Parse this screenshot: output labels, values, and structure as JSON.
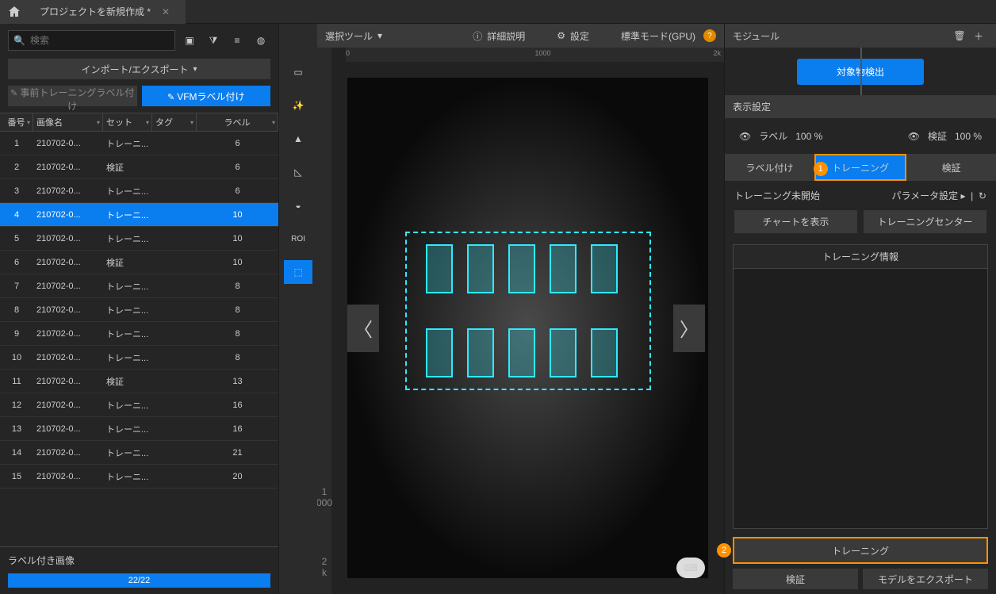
{
  "titlebar": {
    "project": "プロジェクトを新規作成 *"
  },
  "left": {
    "search_placeholder": "検索",
    "import_export": "インポート/エクスポート",
    "pretrain_label": "事前トレーニングラベル付け",
    "vfm_label": "VFMラベル付け",
    "columns": {
      "num": "番号",
      "name": "画像名",
      "set": "セット",
      "tag": "タグ",
      "labels": "ラベル"
    },
    "rows": [
      {
        "n": "1",
        "name": "210702-0...",
        "set": "トレーニ...",
        "tag": "",
        "lab": "6"
      },
      {
        "n": "2",
        "name": "210702-0...",
        "set": "検証",
        "tag": "",
        "lab": "6"
      },
      {
        "n": "3",
        "name": "210702-0...",
        "set": "トレーニ...",
        "tag": "",
        "lab": "6"
      },
      {
        "n": "4",
        "name": "210702-0...",
        "set": "トレーニ...",
        "tag": "",
        "lab": "10"
      },
      {
        "n": "5",
        "name": "210702-0...",
        "set": "トレーニ...",
        "tag": "",
        "lab": "10"
      },
      {
        "n": "6",
        "name": "210702-0...",
        "set": "検証",
        "tag": "",
        "lab": "10"
      },
      {
        "n": "7",
        "name": "210702-0...",
        "set": "トレーニ...",
        "tag": "",
        "lab": "8"
      },
      {
        "n": "8",
        "name": "210702-0...",
        "set": "トレーニ...",
        "tag": "",
        "lab": "8"
      },
      {
        "n": "9",
        "name": "210702-0...",
        "set": "トレーニ...",
        "tag": "",
        "lab": "8"
      },
      {
        "n": "10",
        "name": "210702-0...",
        "set": "トレーニ...",
        "tag": "",
        "lab": "8"
      },
      {
        "n": "11",
        "name": "210702-0...",
        "set": "検証",
        "tag": "",
        "lab": "13"
      },
      {
        "n": "12",
        "name": "210702-0...",
        "set": "トレーニ...",
        "tag": "",
        "lab": "16"
      },
      {
        "n": "13",
        "name": "210702-0...",
        "set": "トレーニ...",
        "tag": "",
        "lab": "16"
      },
      {
        "n": "14",
        "name": "210702-0...",
        "set": "トレーニ...",
        "tag": "",
        "lab": "21"
      },
      {
        "n": "15",
        "name": "210702-0...",
        "set": "トレーニ...",
        "tag": "",
        "lab": "20"
      }
    ],
    "labeled_header": "ラベル付き画像",
    "labeled_count": "22/22"
  },
  "tools": {
    "roi": "ROI"
  },
  "center": {
    "select_tool": "選択ツール",
    "detail": "詳細説明",
    "settings": "設定",
    "mode": "標準モード(GPU)",
    "ruler": {
      "a": "0",
      "b": "1000",
      "c": "2k"
    },
    "vruler": {
      "a": "1",
      "b": "000",
      "c": "2",
      "d": "k"
    }
  },
  "right": {
    "module": "モジュール",
    "node": "対象物検出",
    "display": "表示設定",
    "label_eye": "ラベル",
    "label_pct": "100 %",
    "verify_eye": "検証",
    "verify_pct": "100 %",
    "tabs": {
      "labeling": "ラベル付け",
      "training": "トレーニング",
      "verify": "検証"
    },
    "callout1": "1",
    "train_status": "トレーニング未開始",
    "param": "パラメータ設定",
    "show_chart": "チャートを表示",
    "train_center": "トレーニングセンター",
    "train_info": "トレーニング情報",
    "callout2": "2",
    "train_btn": "トレーニング",
    "verify_btn": "検証",
    "export_btn": "モデルをエクスポート"
  }
}
